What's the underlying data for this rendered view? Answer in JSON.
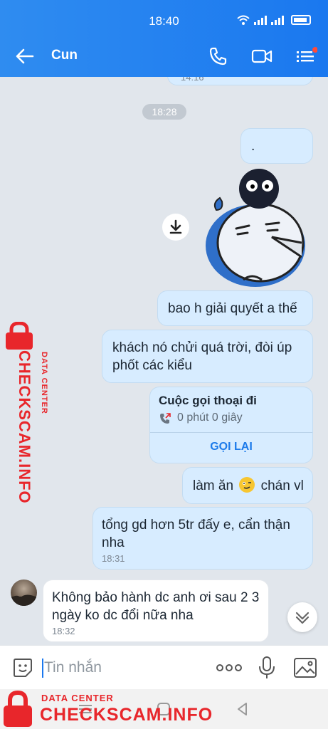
{
  "status_bar": {
    "time": "18:40"
  },
  "app_bar": {
    "contact_name": "Cun"
  },
  "chat": {
    "partial_time": "14:16",
    "date_separator": "18:28",
    "messages": [
      {
        "text": "."
      },
      {
        "text": "bao h giải quyết a thế"
      },
      {
        "text": "khách nó chửi quá trời, đòi úp phốt các kiểu"
      },
      {
        "text_before_emoji": "làm ăn",
        "text_after_emoji": "chán vl"
      },
      {
        "text": "tổng gd hơn 5tr đấy e, cẩn thận nha",
        "time": "18:31"
      },
      {
        "text": "Không bảo hành dc anh ơi sau 2 3 ngày ko dc đổi nữa nha",
        "time": "18:32"
      }
    ],
    "call_card": {
      "title": "Cuộc gọi thoại đi",
      "duration": "0 phút 0 giây",
      "action": "GỌI LẠI"
    }
  },
  "input": {
    "placeholder": "Tin nhắn"
  },
  "watermark": {
    "small": "DATA CENTER",
    "big": "CHECKSCAM.INFO"
  },
  "colors": {
    "header": "#1a78ef",
    "outgoing_bubble": "#d7ecff",
    "incoming_bubble": "#ffffff",
    "watermark": "#e8262b"
  }
}
